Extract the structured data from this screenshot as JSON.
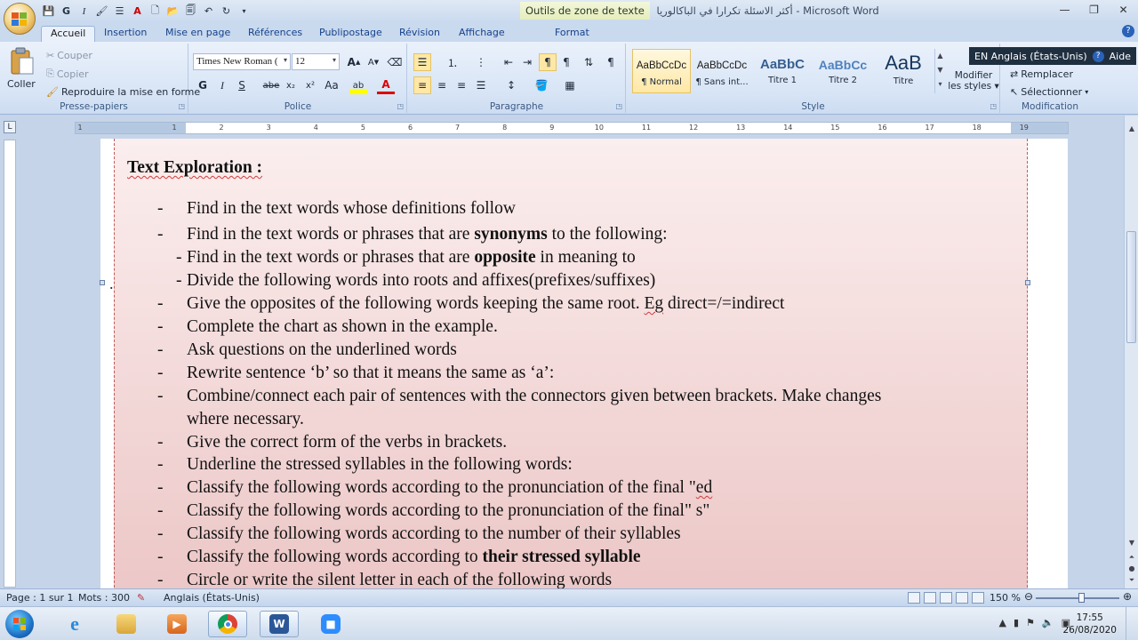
{
  "window": {
    "title": "أكثر الاسئلة تكرارا في الباكالوريا - Microsoft Word",
    "context_tool": "Outils de zone de texte",
    "minimize": "—",
    "maximize": "❐",
    "close": "✕"
  },
  "tabs": [
    "Accueil",
    "Insertion",
    "Mise en page",
    "Références",
    "Publipostage",
    "Révision",
    "Affichage",
    "Format"
  ],
  "ribbon": {
    "clipboard": {
      "label": "Presse-papiers",
      "paste": "Coller",
      "cut": "Couper",
      "copy": "Copier",
      "format_painter": "Reproduire la mise en forme"
    },
    "font": {
      "label": "Police",
      "font_name": "Times New Roman (",
      "font_size": "12",
      "bold": "G",
      "italic": "I",
      "underline": "S",
      "strike": "abe",
      "subscript": "x₂",
      "superscript": "x²",
      "change_case": "Aa",
      "grow": "A",
      "shrink": "A",
      "highlight": "ab",
      "font_color": "A"
    },
    "paragraph": {
      "label": "Paragraphe"
    },
    "styles": {
      "label": "Style",
      "items": [
        {
          "sample": "AaBbCcDc",
          "name": "¶ Normal"
        },
        {
          "sample": "AaBbCcDc",
          "name": "¶ Sans int..."
        },
        {
          "sample": "AaBbC",
          "name": "Titre 1"
        },
        {
          "sample": "AaBbCc",
          "name": "Titre 2"
        },
        {
          "sample": "AaB",
          "name": "Titre"
        }
      ],
      "change_styles": "Modifier les styles"
    },
    "editing": {
      "label": "Modification",
      "replace": "Remplacer",
      "select": "Sélectionner"
    }
  },
  "language_popup": {
    "text": "EN Anglais (États-Unis)",
    "help": "Aide"
  },
  "ruler_ticks": [
    "1",
    "1",
    "2",
    "3",
    "4",
    "5",
    "6",
    "7",
    "8",
    "9",
    "10",
    "11",
    "12",
    "13",
    "14",
    "15",
    "16",
    "17",
    "18",
    "19"
  ],
  "document": {
    "heading": "Text Exploration :",
    "items": [
      {
        "dash": "-",
        "text": "Find in the text words whose definitions follow"
      },
      {
        "dash": "-",
        "pre": "Find in the text words or phrases that are ",
        "bold": "synonyms",
        "post": " to the following:"
      },
      {
        "dash": "- ",
        "pre": "Find in the text words or phrases that are ",
        "bold": "opposite",
        "post": " in meaning  to"
      },
      {
        "dash": "- ",
        "text": "Divide the following words into roots and affixes(prefixes/suffixes)"
      },
      {
        "dash": "-",
        "pre": "Give the opposites of the following words keeping the same root. ",
        "squig": "Eg",
        "post": " direct=/=indirect"
      },
      {
        "dash": "-",
        "text": "Complete the chart as shown in the example."
      },
      {
        "dash": "-",
        "text": "Ask questions on the underlined words"
      },
      {
        "dash": "-",
        "text": "Rewrite sentence ‘b’ so that it means the same as ‘a’:"
      },
      {
        "dash": "-",
        "text": "Combine/connect each pair of sentences with the connectors given between brackets. Make changes"
      },
      {
        "dash": "",
        "text": "where necessary."
      },
      {
        "dash": "-",
        "text": "Give the correct form of the verbs in brackets."
      },
      {
        "dash": "-",
        "text": "Underline the stressed syllables in the following words:"
      },
      {
        "dash": "-",
        "pre": "Classify the following words according to the pronunciation of the final \"",
        "squig": "ed",
        "post": ""
      },
      {
        "dash": "-",
        "text": "Classify the following words according to the pronunciation of the final\" s\""
      },
      {
        "dash": "-",
        "text": " Classify the following words according to the number of their syllables"
      },
      {
        "dash": "-",
        "pre": "Classify the following words according to ",
        "bold": "their stressed syllable",
        "post": ""
      },
      {
        "dash": "-",
        "text": "Circle or write the silent letter in each of the following words"
      }
    ],
    "side_dot": "."
  },
  "statusbar": {
    "page": "Page : 1 sur 1",
    "words": "Mots : 300",
    "language": "Anglais (États-Unis)",
    "zoom": "150 %"
  },
  "taskbar": {
    "time": "17:55",
    "date": "26/08/2020",
    "apps": [
      "internet-explorer",
      "file-explorer",
      "media-player",
      "chrome",
      "word",
      "zoom"
    ]
  },
  "colors": {
    "ribbon": "#dbe7f6",
    "textbox_fill": "#ecc6c6",
    "accent": "#2a62b8"
  }
}
